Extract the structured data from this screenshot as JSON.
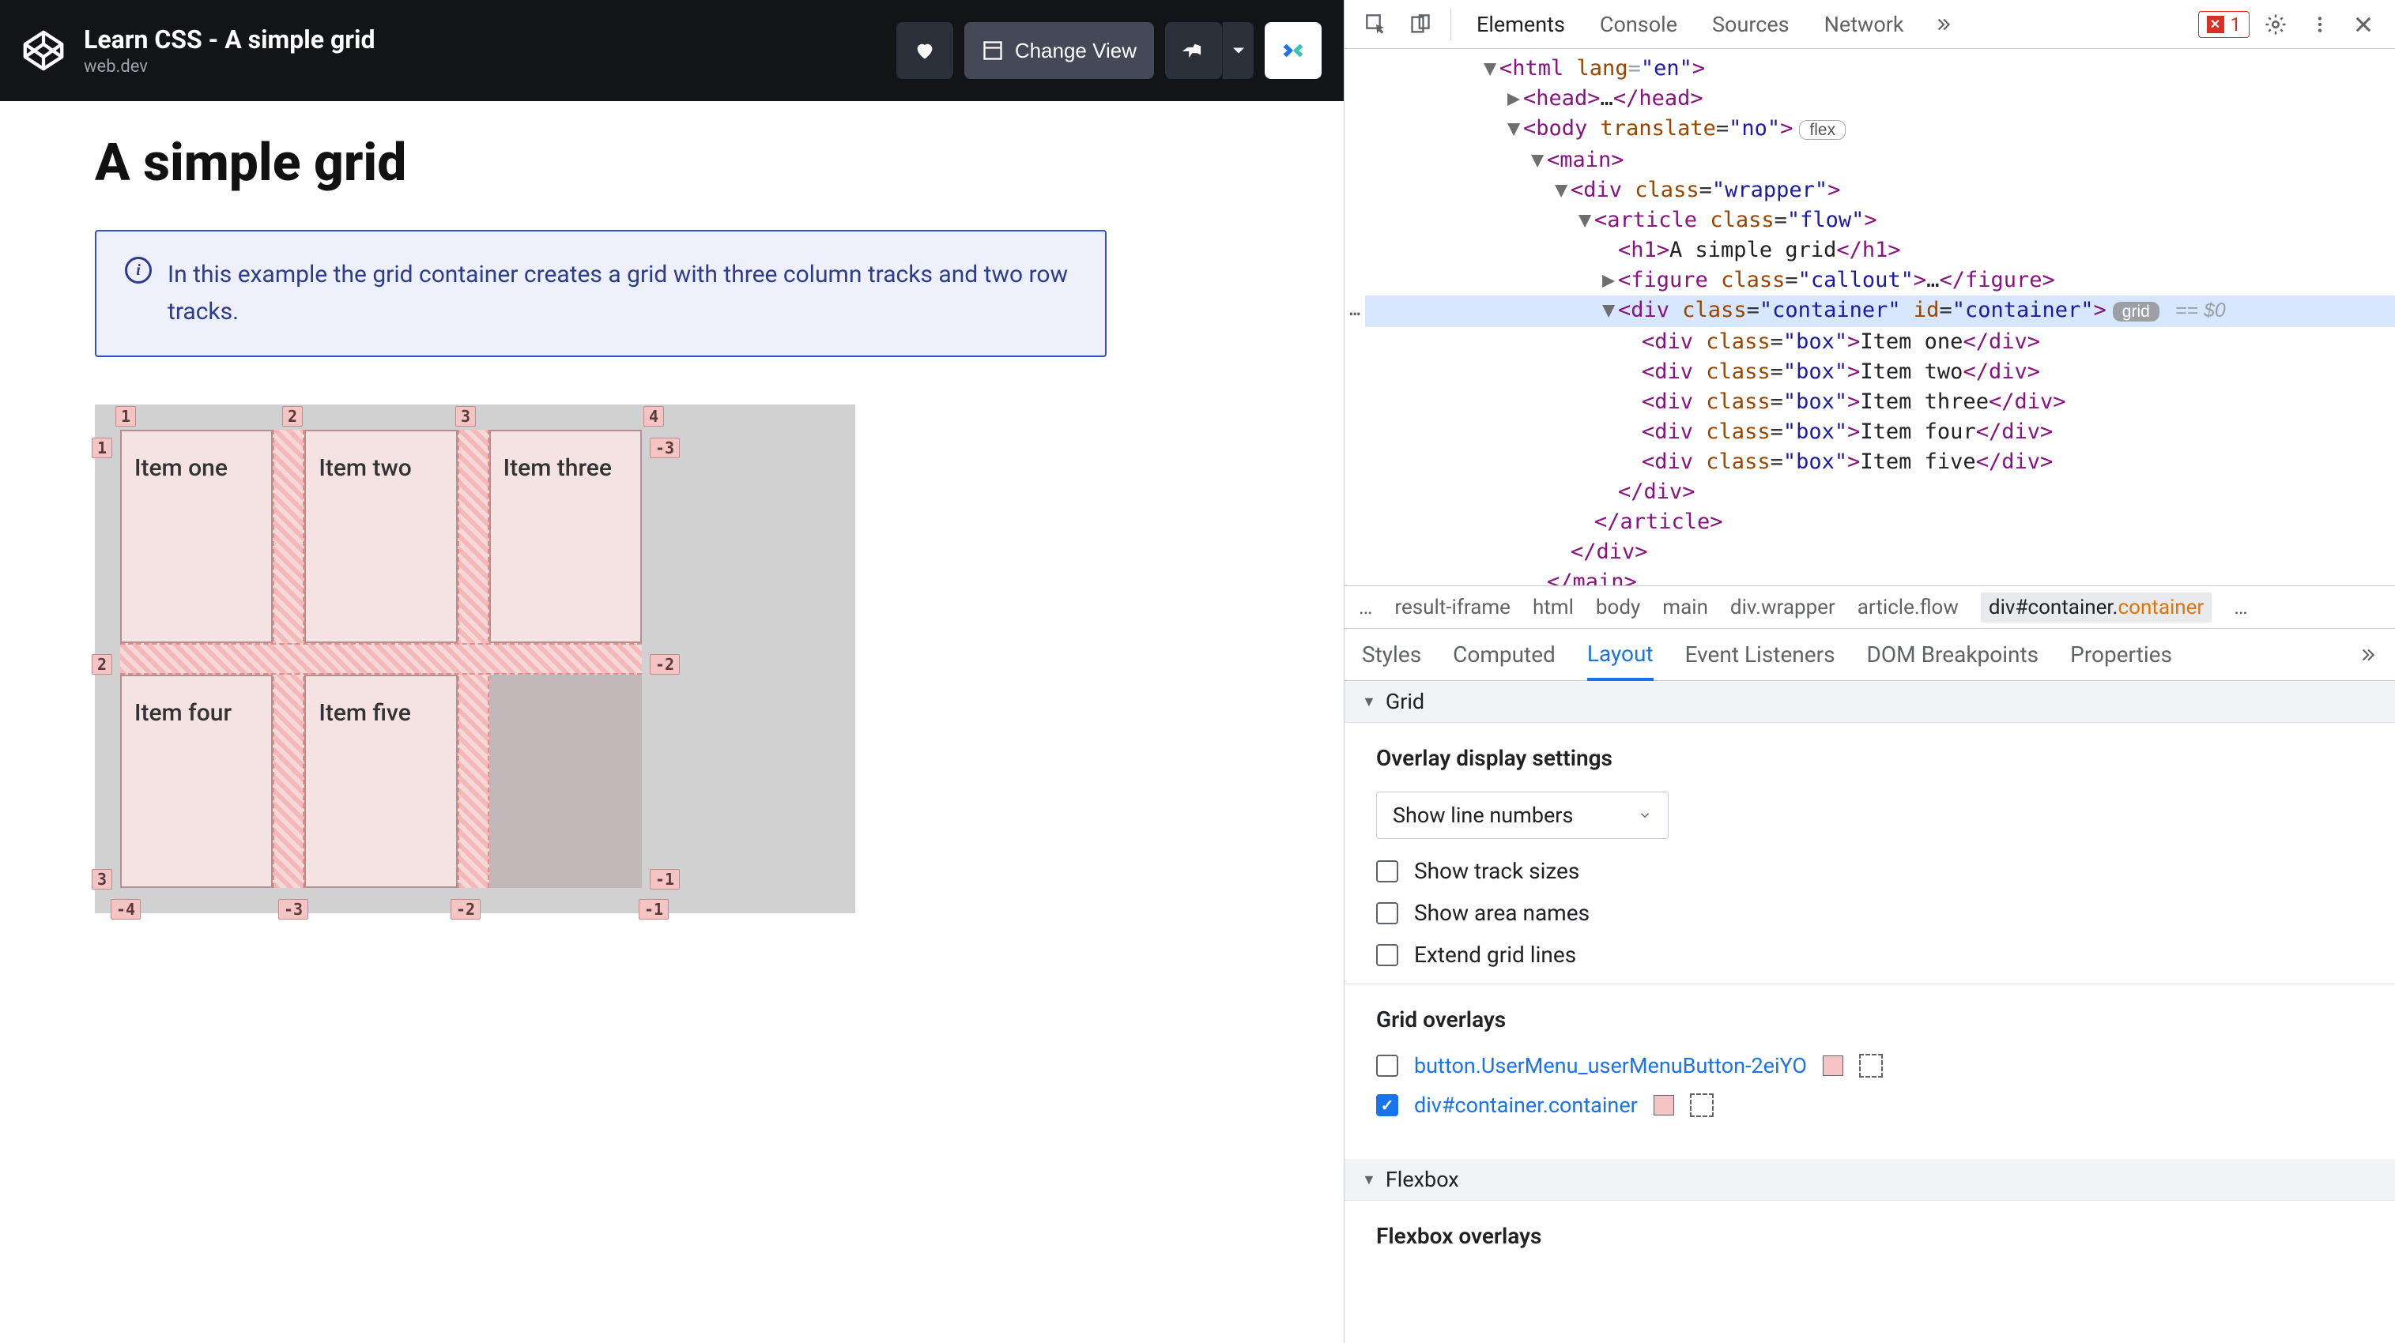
{
  "codepen": {
    "title": "Learn CSS - A simple grid",
    "subtitle": "web.dev",
    "change_view": "Change View"
  },
  "page": {
    "h1": "A simple grid",
    "callout": "In this example the grid container creates a grid with three column tracks and two row tracks."
  },
  "grid_items": [
    "Item one",
    "Item two",
    "Item three",
    "Item four",
    "Item five"
  ],
  "grid_lines": {
    "cols_top": [
      "1",
      "2",
      "3",
      "4"
    ],
    "rows_left": [
      "1",
      "2",
      "3"
    ],
    "cols_bottom": [
      "-4",
      "-3",
      "-2",
      "-1"
    ],
    "rows_right": [
      "-3",
      "-2",
      "-1"
    ]
  },
  "devtools": {
    "tabs": [
      "Elements",
      "Console",
      "Sources",
      "Network"
    ],
    "error_count": "1",
    "dom": {
      "html_open": "<html lang=\"en\">",
      "head": "<head>…</head>",
      "body_open": "<body translate=\"no\">",
      "body_badge": "flex",
      "main_open": "<main>",
      "wrapper_open": "<div class=\"wrapper\">",
      "article_open": "<article class=\"flow\">",
      "h1": "A simple grid",
      "h1_open": "<h1>",
      "h1_close": "</h1>",
      "figure": "<figure class=\"callout\">…</figure>",
      "container_open": "<div class=\"container\" id=\"container\">",
      "container_badge": "grid",
      "container_eq": "== $0",
      "boxes": [
        "Item one",
        "Item two",
        "Item three",
        "Item four",
        "Item five"
      ],
      "box_open": "<div class=\"box\">",
      "box_close": "</div>",
      "div_close": "</div>",
      "article_close": "</article>",
      "main_close": "</main>"
    },
    "crumbs": [
      "…",
      "result-iframe",
      "html",
      "body",
      "main",
      "div.wrapper",
      "article.flow",
      "div#container.container",
      "…"
    ],
    "subtabs": [
      "Styles",
      "Computed",
      "Layout",
      "Event Listeners",
      "DOM Breakpoints",
      "Properties"
    ],
    "layout": {
      "grid_section": "Grid",
      "overlay_heading": "Overlay display settings",
      "select_label": "Show line numbers",
      "check_track": "Show track sizes",
      "check_area": "Show area names",
      "check_extend": "Extend grid lines",
      "overlays_heading": "Grid overlays",
      "overlay1": "button.UserMenu_userMenuButton-2eiYO",
      "overlay2": "div#container.container",
      "flexbox_section": "Flexbox",
      "flexbox_overlays": "Flexbox overlays"
    }
  },
  "colors": {
    "devtools_tag": "#881280",
    "devtools_attr": "#994500",
    "devtools_val": "#1a1aa6",
    "selected_bg": "#d6e7ff",
    "link_blue": "#1a73e8",
    "overlay_pink": "#f5c4c4"
  }
}
